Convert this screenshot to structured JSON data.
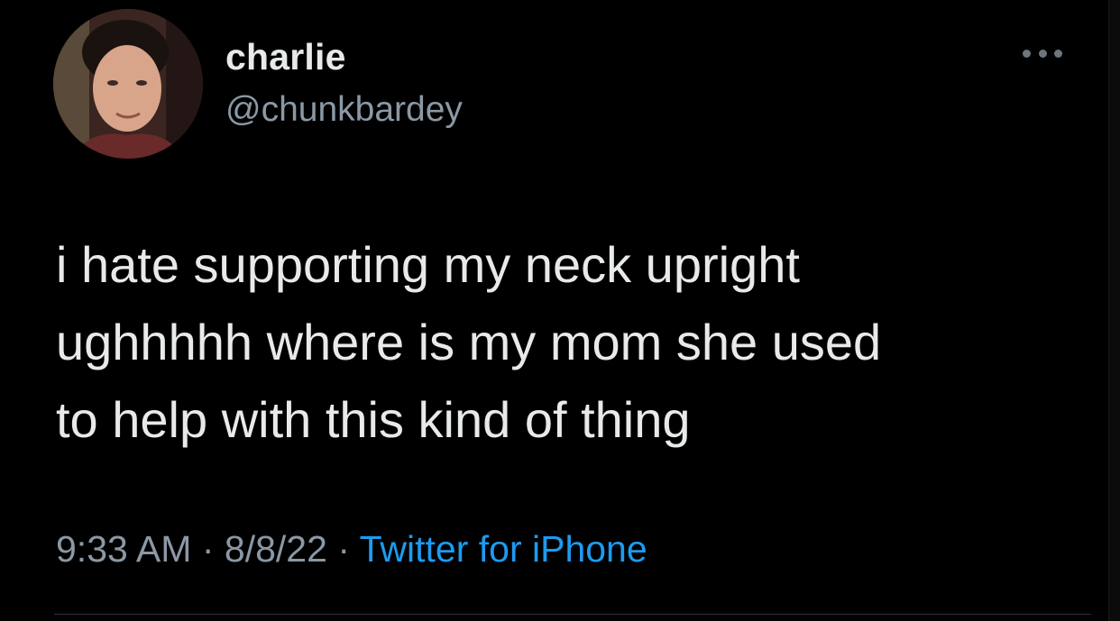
{
  "tweet": {
    "author": {
      "display_name": "charlie",
      "handle": "@chunkbardey",
      "avatar_icon": "profile-photo"
    },
    "more_icon": "more-options-icon",
    "text": "i hate supporting my neck upright\nughhhhh where is my mom she used\nto help with this kind of thing",
    "time": "9:33 AM",
    "separator": "·",
    "date": "8/8/22",
    "source": "Twitter for iPhone"
  },
  "colors": {
    "background": "#000000",
    "primary_text": "#e7e9ea",
    "secondary_text": "#8b98a5",
    "link": "#1d9bf0",
    "divider": "#2f3336"
  }
}
